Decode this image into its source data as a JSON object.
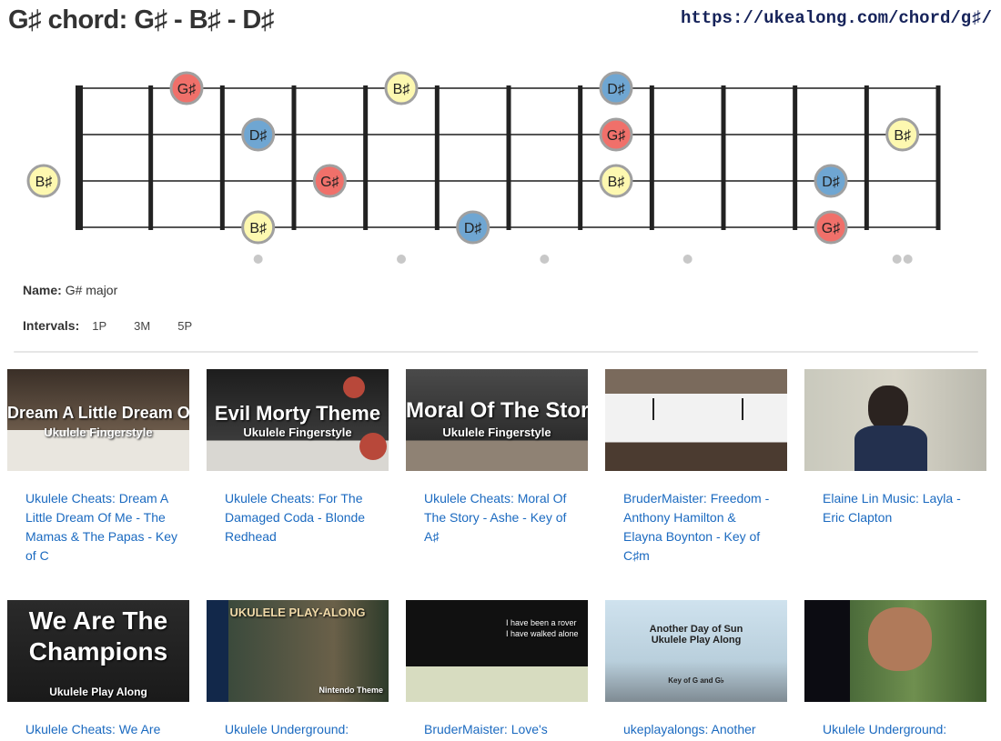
{
  "header": {
    "title": "G♯ chord: G♯ - B♯ - D♯",
    "url": "https://ukealong.com/chord/g♯/"
  },
  "fretboard": {
    "strings": 4,
    "frets": 12,
    "note_colors": {
      "G♯": "#f0706a",
      "B♯": "#fdf8b0",
      "D♯": "#6fa6d2"
    },
    "markers": [
      {
        "string": 2,
        "fret": 0,
        "note": "B♯"
      },
      {
        "string": 0,
        "fret": 2,
        "note": "G♯"
      },
      {
        "string": 3,
        "fret": 3,
        "note": "B♯"
      },
      {
        "string": 1,
        "fret": 3,
        "note": "D♯"
      },
      {
        "string": 2,
        "fret": 4,
        "note": "G♯"
      },
      {
        "string": 0,
        "fret": 5,
        "note": "B♯"
      },
      {
        "string": 3,
        "fret": 6,
        "note": "D♯"
      },
      {
        "string": 2,
        "fret": 8,
        "note": "B♯"
      },
      {
        "string": 1,
        "fret": 8,
        "note": "G♯"
      },
      {
        "string": 0,
        "fret": 8,
        "note": "D♯"
      },
      {
        "string": 3,
        "fret": 11,
        "note": "G♯"
      },
      {
        "string": 2,
        "fret": 11,
        "note": "D♯"
      },
      {
        "string": 1,
        "fret": 12,
        "note": "B♯"
      }
    ],
    "inlay_dots": [
      3,
      5,
      7,
      9,
      12
    ]
  },
  "info": {
    "name_label": "Name:",
    "name_value": "G# major",
    "intervals_label": "Intervals:",
    "intervals": [
      "1P",
      "3M",
      "5P"
    ]
  },
  "videos": [
    {
      "title": "Ukulele Cheats: Dream A Little Dream Of Me - The Mamas & The Papas - Key of C",
      "thumb_text": "Dream A Little Dream Of Me",
      "thumb_sub": "Ukulele Fingerstyle"
    },
    {
      "title": "Ukulele Cheats: For The Damaged Coda - Blonde Redhead",
      "thumb_text": "Evil Morty Theme",
      "thumb_sub": "Ukulele Fingerstyle"
    },
    {
      "title": "Ukulele Cheats: Moral Of The Story - Ashe - Key of A♯",
      "thumb_text": "Moral Of The Story",
      "thumb_sub": "Ukulele Fingerstyle"
    },
    {
      "title": "BruderMaister: Freedom - Anthony Hamilton & Elayna Boynton - Key of C♯m",
      "thumb_text": "",
      "thumb_sub": ""
    },
    {
      "title": "Elaine Lin Music: Layla - Eric Clapton",
      "thumb_text": "",
      "thumb_sub": ""
    },
    {
      "title": "Ukulele Cheats: We Are",
      "thumb_text": "We Are The Champions",
      "thumb_sub": "Ukulele Play Along"
    },
    {
      "title": "Ukulele Underground:",
      "thumb_text": "UKULELE PLAY-ALONG",
      "thumb_sub": "Nintendo Theme"
    },
    {
      "title": "BruderMaister: Love's",
      "thumb_text": "I have been a rover",
      "thumb_sub": "I have walked alone"
    },
    {
      "title": "ukeplayalongs: Another",
      "thumb_text": "Another Day of Sun Ukulele Play Along",
      "thumb_sub": "Key of G and G♭"
    },
    {
      "title": "Ukulele Underground:",
      "thumb_text": "",
      "thumb_sub": ""
    }
  ]
}
